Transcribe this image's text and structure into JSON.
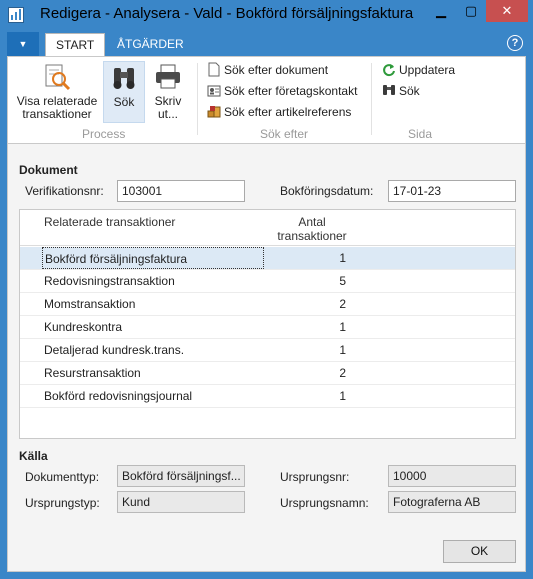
{
  "window": {
    "title": "Redigera - Analysera - Vald - Bokförd försäljningsfaktura",
    "minimize_glyph": "▁",
    "maximize_glyph": "▢",
    "close_glyph": "✕"
  },
  "ribbon": {
    "menu_glyph": "▼",
    "tabs": [
      {
        "label": "START",
        "active": true
      },
      {
        "label": "ÅTGÄRDER",
        "active": false
      }
    ],
    "help_glyph": "?",
    "groups": {
      "process": {
        "label": "Process",
        "buttons": [
          {
            "label_line1": "Visa relaterade",
            "label_line2": "transaktioner",
            "icon": "magnifier-document-icon"
          },
          {
            "label_line1": "Sök",
            "label_line2": "",
            "icon": "binoculars-icon"
          },
          {
            "label_line1": "Skriv",
            "label_line2": "ut...",
            "icon": "printer-icon"
          }
        ]
      },
      "search": {
        "label": "Sök efter",
        "items": [
          {
            "label": "Sök efter dokument",
            "icon": "document-icon"
          },
          {
            "label": "Sök efter företagskontakt",
            "icon": "contact-card-icon"
          },
          {
            "label": "Sök efter artikelreferens",
            "icon": "item-reference-icon"
          }
        ]
      },
      "page": {
        "label": "Sida",
        "items": [
          {
            "label": "Uppdatera",
            "icon": "refresh-icon"
          },
          {
            "label": "Sök",
            "icon": "binoculars-icon"
          }
        ]
      }
    }
  },
  "document": {
    "section_title": "Dokument",
    "verification_label": "Verifikationsnr:",
    "verification_value": "103001",
    "posting_date_label": "Bokföringsdatum:",
    "posting_date_value": "17-01-23"
  },
  "grid": {
    "col_related": "Relaterade transaktioner",
    "col_count_line1": "Antal",
    "col_count_line2": "transaktioner",
    "rows": [
      {
        "name": "Bokförd försäljningsfaktura",
        "count": "1",
        "selected": true
      },
      {
        "name": "Redovisningstransaktion",
        "count": "5",
        "selected": false
      },
      {
        "name": "Momstransaktion",
        "count": "2",
        "selected": false
      },
      {
        "name": "Kundreskontra",
        "count": "1",
        "selected": false
      },
      {
        "name": "Detaljerad kundresk.trans.",
        "count": "1",
        "selected": false
      },
      {
        "name": "Resurstransaktion",
        "count": "2",
        "selected": false
      },
      {
        "name": "Bokförd redovisningsjournal",
        "count": "1",
        "selected": false
      }
    ]
  },
  "source": {
    "section_title": "Källa",
    "doc_type_label": "Dokumenttyp:",
    "doc_type_value": "Bokförd försäljningsf...",
    "origin_no_label": "Ursprungsnr:",
    "origin_no_value": "10000",
    "origin_type_label": "Ursprungstyp:",
    "origin_type_value": "Kund",
    "origin_name_label": "Ursprungsnamn:",
    "origin_name_value": "Fotograferna AB"
  },
  "footer": {
    "ok_label": "OK"
  }
}
